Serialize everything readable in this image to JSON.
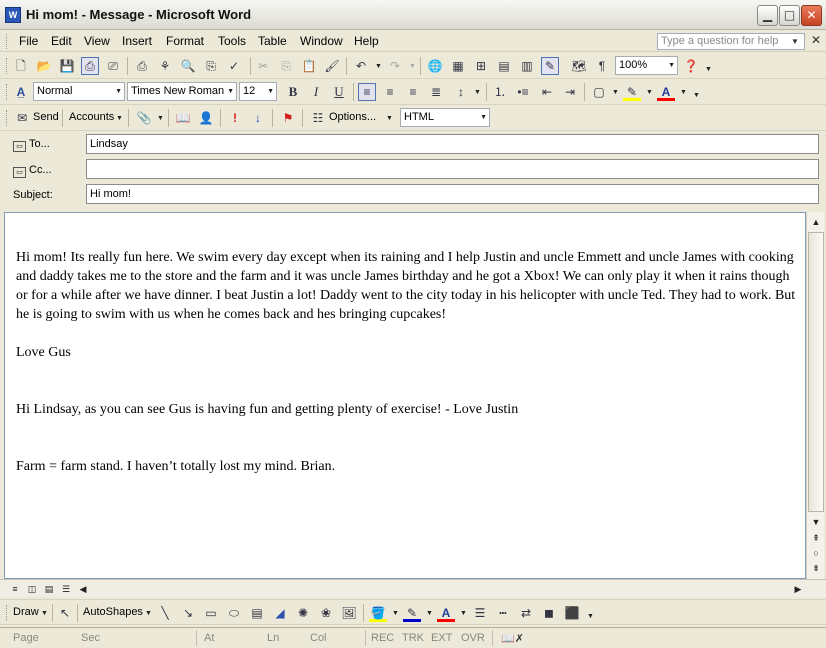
{
  "window": {
    "title": "Hi mom! - Message - Microsoft Word",
    "app_icon": "W"
  },
  "menu": {
    "items": [
      "File",
      "Edit",
      "View",
      "Insert",
      "Format",
      "Tools",
      "Table",
      "Window",
      "Help"
    ],
    "help_placeholder": "Type a question for help"
  },
  "standard_toolbar": {
    "zoom": "100%",
    "icons": [
      "new-icon",
      "open-icon",
      "save-icon",
      "permission-icon",
      "print-preview-icon",
      "print-icon",
      "research-icon",
      "preview-icon",
      "spelling-icon",
      "cut-icon",
      "copy-icon",
      "paste-icon",
      "format-painter-icon",
      "undo-icon",
      "redo-icon",
      "hyperlink-icon",
      "tables-borders-icon",
      "insert-table-icon",
      "insert-excel-icon",
      "columns-icon",
      "drawing-icon",
      "document-map-icon",
      "show-hide-icon",
      "help-icon"
    ]
  },
  "format_toolbar": {
    "style": "Normal",
    "font": "Times New Roman",
    "size": "12"
  },
  "email_toolbar": {
    "send_label": "Send",
    "accounts_label": "Accounts",
    "options_label": "Options...",
    "format": "HTML"
  },
  "header": {
    "to_label": "To...",
    "to_value": "Lindsay",
    "cc_label": "Cc...",
    "cc_value": "",
    "subject_label": "Subject:",
    "subject_value": "Hi mom!"
  },
  "body": {
    "p1": "Hi mom! Its really fun here. We swim every day except when its raining and I help Justin and uncle Emmett and uncle James with cooking and daddy takes me to the store and the farm and it was uncle James birthday and he got a Xbox! We can only play it when it rains though or for a while after we have dinner. I beat Justin a lot! Daddy went to the city today in his helicopter with uncle Ted. They had to work. But he is going to swim with us when he comes back and hes bringing cupcakes!",
    "p2": "Love Gus",
    "p3": "Hi Lindsay, as you can see Gus is having fun and getting plenty of exercise!  - Love Justin",
    "p4": "Farm = farm stand. I haven’t totally lost my mind. Brian."
  },
  "draw_toolbar": {
    "draw_label": "Draw",
    "autoshapes_label": "AutoShapes"
  },
  "status": {
    "page": "Page",
    "sec": "Sec",
    "at": "At",
    "ln": "Ln",
    "col": "Col",
    "rec": "REC",
    "trk": "TRK",
    "ext": "EXT",
    "ovr": "OVR"
  },
  "colors": {
    "highlight": "#ffff00",
    "font_color": "#ff0000",
    "line_color": "#0000cc"
  }
}
